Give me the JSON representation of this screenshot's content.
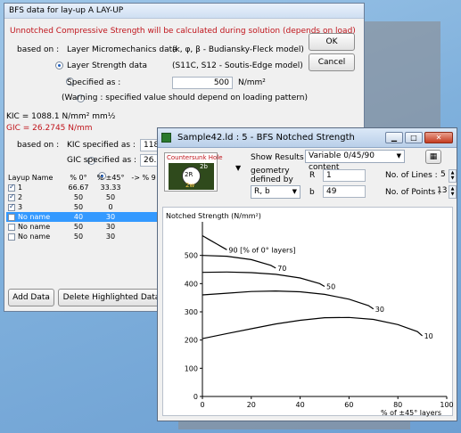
{
  "bfs_dialog": {
    "title": "BFS data for lay-up A LAY-UP",
    "warning_line": "Unnotched Compressive Strength will be calculated during solution (depends on load)",
    "based_on_label": "based on :",
    "opt_micromechanics": "Layer Micromechanics data",
    "opt_micromechanics_note": "(k, φ, β - Budiansky-Fleck model)",
    "opt_layer_strength": "Layer Strength data",
    "opt_layer_strength_note": "(S11C, S12 - Soutis-Edge model)",
    "opt_specified": "Specified as :",
    "specified_value": "500",
    "specified_unit": "N/mm²",
    "specified_warning": "(Warning : specified value should depend on loading pattern)",
    "kic_line": "KIC = 1088.1 N/mm² mm½",
    "gic_line": "GIC = 26.2745 N/mm",
    "based_on_label2": "based on :",
    "opt_kic": "KIC specified as :",
    "kic_value": "118",
    "opt_gic": "GIC specified as :",
    "gic_value": "26.",
    "ok_label": "OK",
    "cancel_label": "Cancel",
    "table": {
      "headers": [
        "Layup Name",
        "% 0°",
        "% ±45°",
        "-> % 9"
      ],
      "rows": [
        {
          "name": "1",
          "p0": "66.67",
          "p45": "33.33",
          "checked": true,
          "selected": false
        },
        {
          "name": "2",
          "p0": "50",
          "p45": "50",
          "checked": true,
          "selected": false
        },
        {
          "name": "3",
          "p0": "50",
          "p45": "0",
          "checked": true,
          "selected": false
        },
        {
          "name": "No name",
          "p0": "40",
          "p45": "30",
          "checked": false,
          "selected": true
        },
        {
          "name": "No name",
          "p0": "50",
          "p45": "30",
          "checked": false,
          "selected": false
        },
        {
          "name": "No name",
          "p0": "50",
          "p45": "30",
          "checked": false,
          "selected": false
        }
      ]
    },
    "add_data_label": "Add Data",
    "delete_label": "Delete Highlighted Data  (cannot"
  },
  "notched_window": {
    "title": "Sample42.ld : 5 - BFS Notched Strength",
    "hole_label": "Countersunk Hole",
    "hole_dim_2r": "2R",
    "hole_dim_2b": "2b",
    "hole_dim_2w": "2w",
    "show_results_label": "Show Results for :",
    "show_results_value": "Variable 0/45/90 content",
    "geometry_label": "geometry defined by",
    "geometry_value": "R, b",
    "r_label": "R",
    "r_value": "1",
    "b_label": "b",
    "b_value": "49",
    "lines_label": "No. of Lines :",
    "lines_value": "5",
    "points_label": "No. of Points :",
    "points_value": "13"
  },
  "chart_data": {
    "type": "line",
    "title": "Notched Strength (N/mm²)",
    "xlabel": "% of ±45° layers",
    "ylabel": "Notched Strength (N/mm²)",
    "xlim": [
      0,
      100
    ],
    "ylim": [
      0,
      600
    ],
    "xticks": [
      0,
      20,
      40,
      60,
      80,
      100
    ],
    "yticks": [
      0,
      100,
      200,
      300,
      400,
      500
    ],
    "series": [
      {
        "name": "90 [% of 0° layers]",
        "x": [
          0,
          3,
          6,
          8,
          10
        ],
        "y": [
          570,
          555,
          540,
          530,
          520
        ]
      },
      {
        "name": "70",
        "x": [
          0,
          10,
          20,
          28,
          30
        ],
        "y": [
          500,
          497,
          485,
          465,
          455
        ]
      },
      {
        "name": "50",
        "x": [
          0,
          10,
          20,
          30,
          40,
          48,
          50
        ],
        "y": [
          440,
          441,
          439,
          433,
          420,
          400,
          390
        ]
      },
      {
        "name": "30",
        "x": [
          0,
          10,
          20,
          30,
          40,
          50,
          60,
          68,
          70
        ],
        "y": [
          360,
          366,
          372,
          374,
          371,
          362,
          345,
          322,
          310
        ]
      },
      {
        "name": "10",
        "x": [
          0,
          10,
          20,
          30,
          40,
          50,
          60,
          70,
          80,
          88,
          90
        ],
        "y": [
          205,
          223,
          240,
          257,
          270,
          279,
          280,
          273,
          255,
          230,
          215
        ]
      }
    ]
  }
}
